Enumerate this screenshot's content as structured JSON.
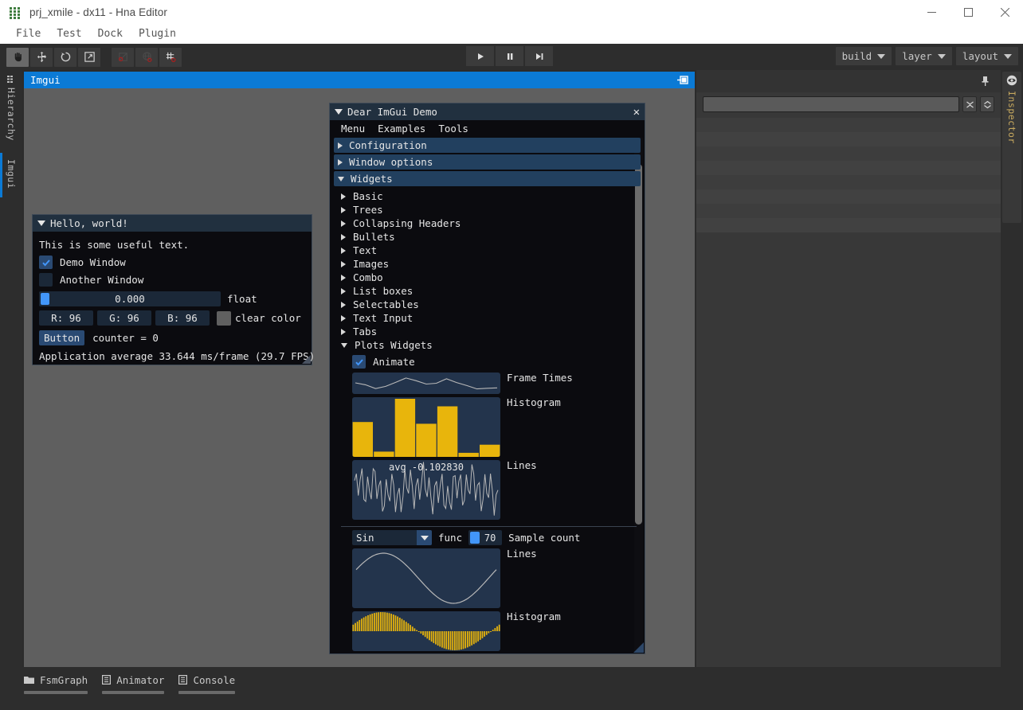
{
  "window": {
    "title": "prj_xmile - dx11 - Hna Editor",
    "logo_icon": "grid-apps-icon",
    "minimize_icon": "minimize-icon",
    "maximize_icon": "maximize-icon",
    "close_icon": "close-icon"
  },
  "menubar": {
    "items": [
      "File",
      "Test",
      "Dock",
      "Plugin"
    ]
  },
  "toolbar": {
    "tools": [
      {
        "name": "hand-tool",
        "icon": "hand-icon",
        "active": true
      },
      {
        "name": "move-tool",
        "icon": "move-arrows-icon",
        "active": false
      },
      {
        "name": "rotate-tool",
        "icon": "rotate-icon",
        "active": false
      },
      {
        "name": "scale-tool",
        "icon": "scale-expand-icon",
        "active": false
      }
    ],
    "modes": [
      {
        "name": "local-space-toggle",
        "icon": "square-pivot-icon"
      },
      {
        "name": "global-space-toggle",
        "icon": "globe-pivot-icon"
      },
      {
        "name": "grid-snap-toggle",
        "icon": "grid-snap-icon"
      }
    ],
    "playback": [
      {
        "name": "play-button",
        "icon": "play-icon"
      },
      {
        "name": "pause-button",
        "icon": "pause-icon"
      },
      {
        "name": "step-forward-button",
        "icon": "step-forward-icon"
      }
    ],
    "dropdowns": [
      {
        "label": "build",
        "icon": "chevron-down-icon"
      },
      {
        "label": "layer",
        "icon": "chevron-down-icon"
      },
      {
        "label": "layout",
        "icon": "chevron-down-icon"
      }
    ]
  },
  "left_tabs": [
    {
      "label": "Hierarchy",
      "icon": "hierarchy-icon",
      "active": false
    },
    {
      "label": "Imgui",
      "icon": "",
      "active": true
    }
  ],
  "dock": {
    "tab_label": "Imgui",
    "dock_icon": "dock-window-icon"
  },
  "inspector": {
    "label": "Inspector",
    "eye_icon": "eye-icon",
    "pin_icon": "pin-icon",
    "search_value": "",
    "search_placeholder": "",
    "btn_collapse_icon": "collapse-all-icon",
    "btn_expand_icon": "expand-all-icon",
    "row_count": 8
  },
  "bottom_tabs": [
    {
      "label": "FsmGraph",
      "icon": "folder-icon"
    },
    {
      "label": "Animator",
      "icon": "list-icon"
    },
    {
      "label": "Console",
      "icon": "list-icon"
    }
  ],
  "hello_window": {
    "title": "Hello, world!",
    "collapse_icon": "triangle-down-icon",
    "text": "This is some useful text.",
    "checkboxes": [
      {
        "label": "Demo Window",
        "checked": true
      },
      {
        "label": "Another Window",
        "checked": false
      }
    ],
    "float_slider": {
      "value": "0.000",
      "label": "float"
    },
    "color_buttons": [
      "R: 96",
      "G: 96",
      "B: 96"
    ],
    "color_label": "clear color",
    "color_swatch": "#606060",
    "button_label": "Button",
    "counter_text": "counter = 0",
    "stats": "Application average 33.644 ms/frame (29.7 FPS)"
  },
  "demo_window": {
    "title": "Dear ImGui Demo",
    "collapse_icon": "triangle-down-icon",
    "close_icon": "close-icon",
    "menu": [
      "Menu",
      "Examples",
      "Tools"
    ],
    "headers": [
      {
        "label": "Configuration",
        "open": false
      },
      {
        "label": "Window options",
        "open": false
      },
      {
        "label": "Widgets",
        "open": true
      }
    ],
    "widget_items": [
      {
        "label": "Basic",
        "open": false
      },
      {
        "label": "Trees",
        "open": false
      },
      {
        "label": "Collapsing Headers",
        "open": false
      },
      {
        "label": "Bullets",
        "open": false
      },
      {
        "label": "Text",
        "open": false
      },
      {
        "label": "Images",
        "open": false
      },
      {
        "label": "Combo",
        "open": false
      },
      {
        "label": "List boxes",
        "open": false
      },
      {
        "label": "Selectables",
        "open": false
      },
      {
        "label": "Text Input",
        "open": false
      },
      {
        "label": "Tabs",
        "open": false
      },
      {
        "label": "Plots Widgets",
        "open": true
      }
    ],
    "plots": {
      "animate_label": "Animate",
      "animate_checked": true,
      "frame_times_label": "Frame Times",
      "histogram_label": "Histogram",
      "lines_label": "Lines",
      "lines_overlay": "avg -0.102830",
      "func_combo_value": "Sin",
      "func_label": "func",
      "sample_count_value": "70",
      "sample_count_label": "Sample count",
      "lines2_label": "Lines",
      "histogram2_label": "Histogram"
    }
  },
  "colors": {
    "accent_blue": "#0b7ad5",
    "imgui_plot_bg": "#23344c",
    "imgui_plot_bar": "#e8b50c",
    "imgui_plot_line": "#b8b8b8",
    "imgui_header": "#22405f",
    "imgui_frame": "#1b2838",
    "imgui_titlebar": "#21303f",
    "inspector_label": "#c7a95f"
  },
  "chart_data": [
    {
      "type": "line",
      "title": "Frame Times",
      "values": [
        0.58,
        0.45,
        0.2,
        0.35,
        0.62,
        0.9,
        0.72,
        0.5,
        0.55,
        0.85,
        0.6,
        0.4,
        0.18,
        0.22,
        0.25
      ],
      "ylim": [
        0,
        1
      ],
      "grid": false
    },
    {
      "type": "bar",
      "title": "Histogram",
      "categories": [
        "0",
        "1",
        "2",
        "3",
        "4",
        "5",
        "6"
      ],
      "values": [
        0.6,
        0.09,
        1.0,
        0.57,
        0.87,
        0.07,
        0.21
      ],
      "ylim": [
        0,
        1
      ],
      "grid": false
    },
    {
      "type": "line",
      "title": "Lines",
      "annotation": "avg -0.102830",
      "ylim": [
        -1,
        1
      ],
      "grid": false,
      "note": "high-frequency noisy oscillating signal, ~60 samples"
    },
    {
      "type": "line",
      "title": "Lines",
      "function": "Sin",
      "sample_count": 70,
      "ylim": [
        -1,
        1
      ],
      "grid": false
    },
    {
      "type": "bar",
      "title": "Histogram",
      "function": "Sin",
      "sample_count": 70,
      "ylim": [
        -1,
        1
      ],
      "grid": false
    }
  ]
}
